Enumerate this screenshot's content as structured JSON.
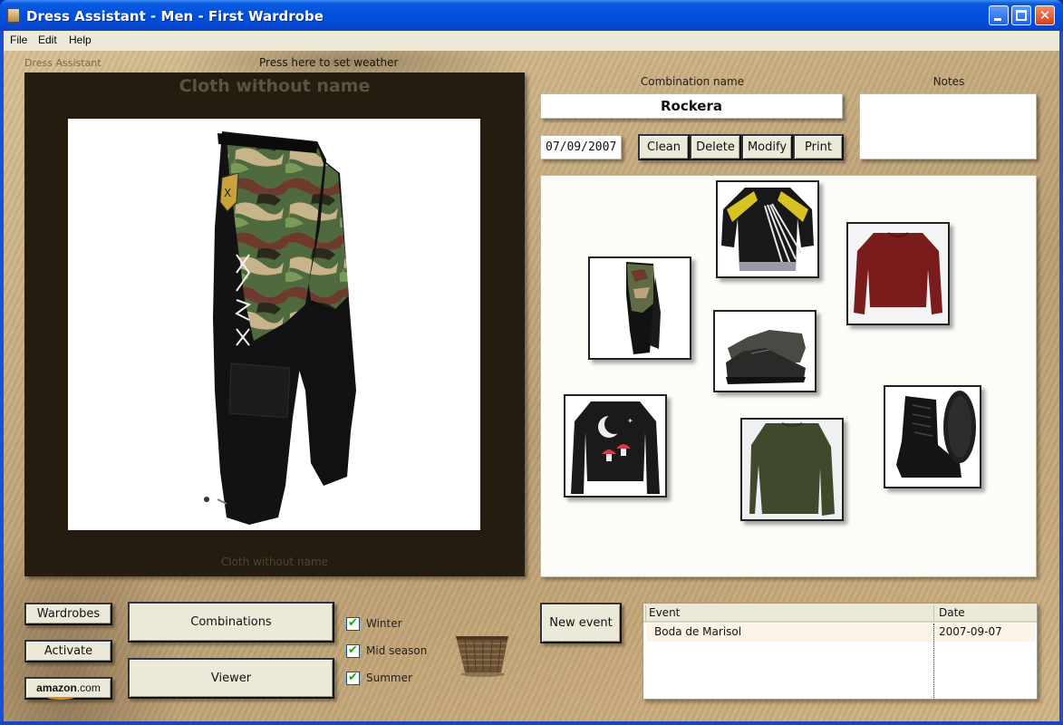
{
  "window": {
    "title": "Dress Assistant - Men - First Wardrobe",
    "controls": {
      "minimize": "minimize",
      "maximize": "maximize",
      "close": "✕"
    }
  },
  "menu": [
    {
      "label": "File"
    },
    {
      "label": "Edit"
    },
    {
      "label": "Help"
    }
  ],
  "header": {
    "brand": "Dress Assistant",
    "weather_link": "Press here to set weather"
  },
  "viewer": {
    "title": "Cloth without name",
    "caption": "Cloth without name",
    "image": "camouflage-pants"
  },
  "combination": {
    "name_label": "Combination name",
    "name_value": "Rockera",
    "notes_label": "Notes",
    "notes_value": "",
    "date_value": "07/09/2007",
    "buttons": {
      "clean": "Clean",
      "delete": "Delete",
      "modify": "Modify",
      "print": "Print"
    },
    "items": [
      {
        "name": "camouflage-pants"
      },
      {
        "name": "motocross-jersey"
      },
      {
        "name": "red-sweater"
      },
      {
        "name": "black-shoes"
      },
      {
        "name": "black-moon-sweatshirt"
      },
      {
        "name": "green-sweater"
      },
      {
        "name": "black-boots"
      }
    ]
  },
  "bottom": {
    "wardrobes": "Wardrobes",
    "activate": "Activate",
    "amazon": {
      "brand": "amazon",
      "suffix": ".com"
    },
    "combinations": "Combinations",
    "viewer": "Viewer",
    "seasons": [
      {
        "label": "Winter",
        "checked": true
      },
      {
        "label": "Mid season",
        "checked": true
      },
      {
        "label": "Summer",
        "checked": true
      }
    ],
    "check_glyph": "✔",
    "new_event": "New event"
  },
  "events": {
    "columns": [
      "Event",
      "Date"
    ],
    "rows": [
      {
        "event": "Boda de Marisol",
        "date": "2007-09-07"
      }
    ]
  },
  "colors": {
    "titlebar": "#0050de",
    "panel_dark": "#251c10",
    "button_face": "#ece9d8",
    "check_green": "#21a121"
  }
}
